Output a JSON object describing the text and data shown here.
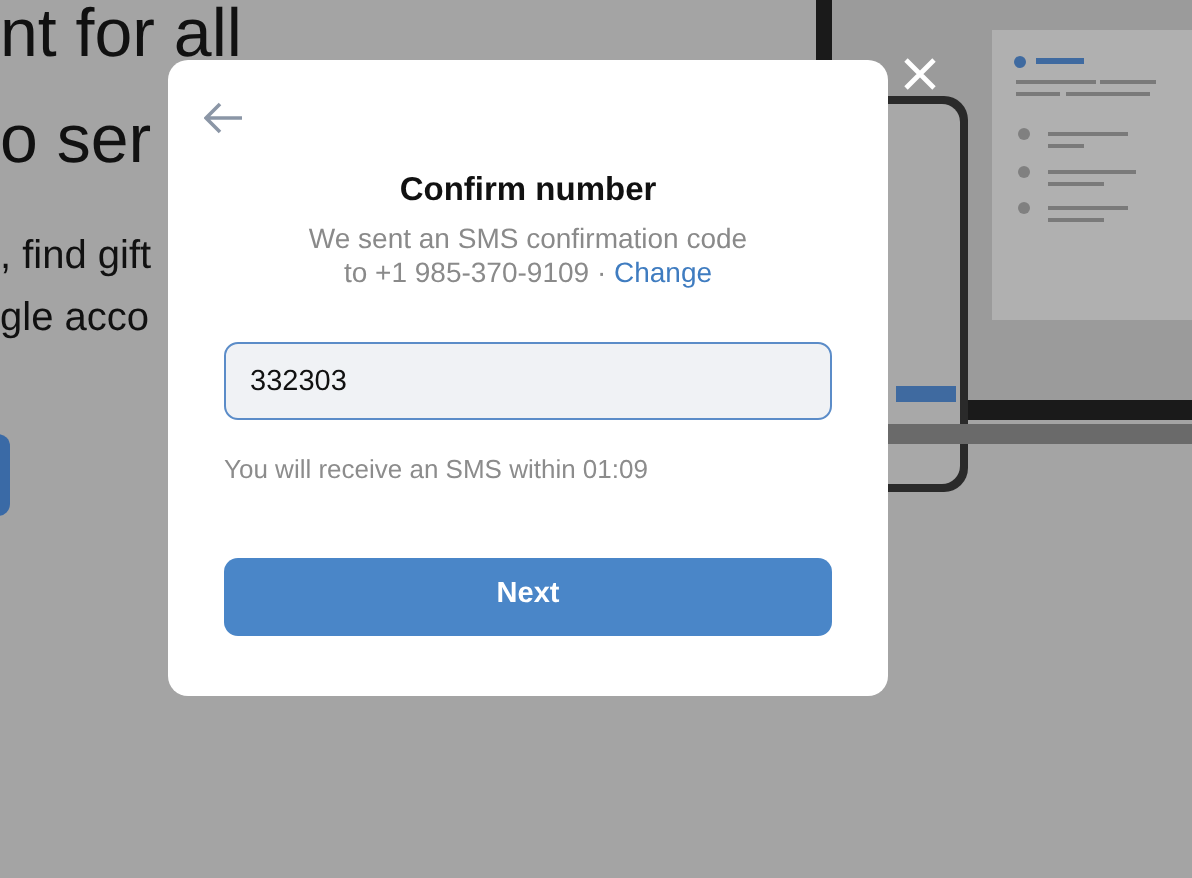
{
  "background": {
    "headline_lines": [
      "nt for all",
      "o ser"
    ],
    "body_lines": [
      ", find gift",
      "gle acco"
    ]
  },
  "dialog": {
    "title": "Confirm number",
    "message_lines": [
      "We sent an SMS confirmation code",
      "to +1 985-370-9109 ·"
    ],
    "change_link": "Change",
    "code_field": {
      "value": "332303"
    },
    "hint": "You will receive an SMS within 01:09",
    "next_button": "Next"
  }
}
